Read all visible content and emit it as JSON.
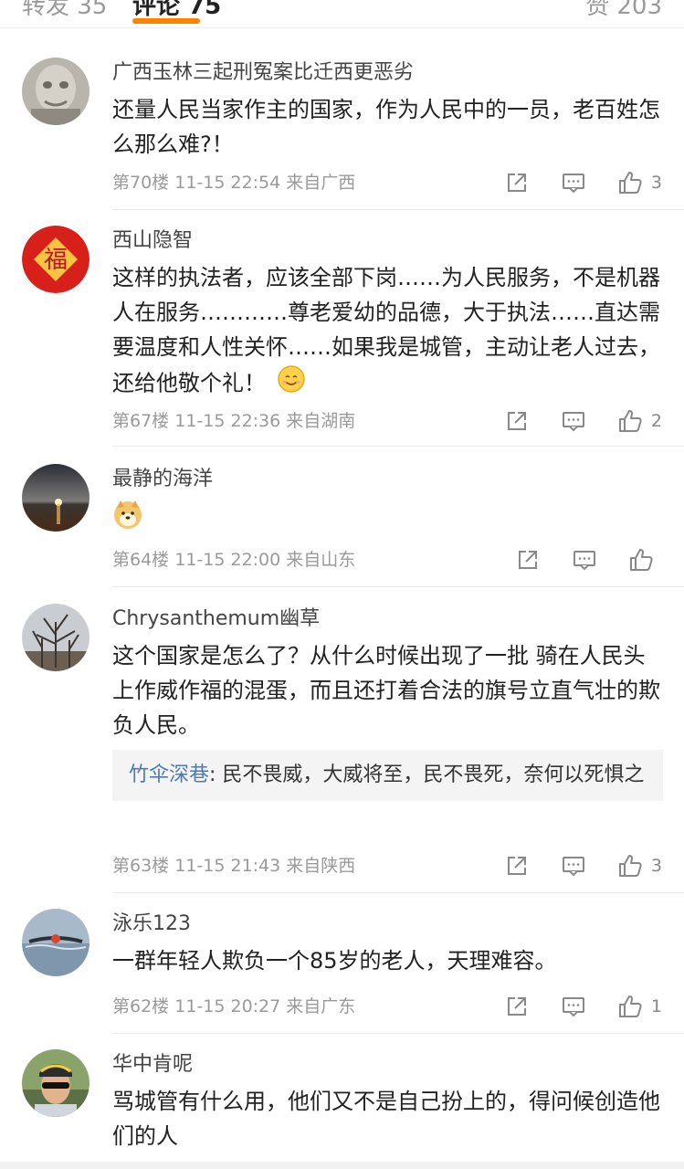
{
  "tabs": [
    {
      "label": "转发 35"
    },
    {
      "label": "评论 75"
    },
    {
      "label": "赞 203"
    }
  ],
  "comments": [
    {
      "username": "广西玉林三起刑冤案比迁西更恶劣",
      "content": "还量人民当家作主的国家，作为人民中的一员，老百姓怎么那么难?！",
      "floor": "第70楼",
      "time": "11-15 22:54",
      "location": "来自广西",
      "likes": "3",
      "avatar_icon": "stone-statue-avatar"
    },
    {
      "username": "西山隐智",
      "content": "这样的执法者，应该全部下岗……为人民服务，不是机器人在服务…………尊老爱幼的品德，大于执法……直达需要温度和人性关怀……如果我是城管，主动让老人过去，还给他敬个礼！",
      "floor": "第67楼",
      "time": "11-15 22:36",
      "location": "来自湖南",
      "likes": "2",
      "avatar_icon": "fu-character-avatar",
      "emoji_icon": "smile-emoji"
    },
    {
      "username": "最静的海洋",
      "content": "",
      "floor": "第64楼",
      "time": "11-15 22:00",
      "location": "来自山东",
      "likes": "",
      "avatar_icon": "sunset-sea-avatar",
      "emoji_icon": "doge-emoji"
    },
    {
      "username": "Chrysanthemum幽草",
      "content": "这个国家是怎么了？从什么时候出现了一批 骑在人民头上作威作福的混蛋，而且还打着合法的旗号立直气壮的欺负人民。",
      "floor": "第63楼",
      "time": "11-15 21:43",
      "location": "来自陕西",
      "likes": "3",
      "avatar_icon": "bare-trees-avatar",
      "reply": {
        "user": "竹伞深巷",
        "text": ": 民不畏威，大威将至，民不畏死，奈何以死惧之"
      }
    },
    {
      "username": "泳乐123",
      "content": "一群年轻人欺负一个85岁的老人，天理难容。",
      "floor": "第62楼",
      "time": "11-15 20:27",
      "location": "来自广东",
      "likes": "1",
      "avatar_icon": "swimmer-avatar"
    },
    {
      "username": "华中肯呢",
      "content": "骂城管有什么用，他们又不是自己扮上的，得问候创造他们的人",
      "avatar_icon": "cyclist-avatar"
    }
  ],
  "colors": {
    "accent": "#ff8200",
    "reply_user": "#4d7ab3",
    "meta": "#9a9a9a"
  }
}
